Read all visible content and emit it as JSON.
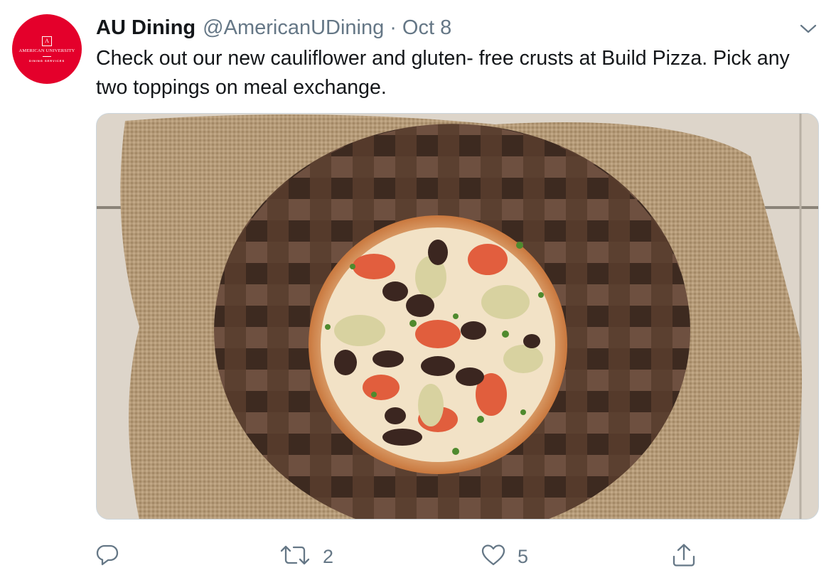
{
  "account": {
    "display_name": "AU Dining",
    "handle": "@AmericanUDining",
    "separator": "·",
    "date": "Oct 8",
    "avatar": {
      "color": "#e4002b",
      "line1": "AMERICAN UNIVERSITY",
      "line2": "DINING SERVICES"
    }
  },
  "tweet": {
    "text": "Check out our new cauliflower and gluten- free crusts at Build Pizza. Pick any two toppings on meal exchange."
  },
  "media": {
    "icon": "photo-pizza-on-wooden-board"
  },
  "actions": {
    "reply": {
      "icon": "reply-icon",
      "count": ""
    },
    "retweet": {
      "icon": "retweet-icon",
      "count": "2"
    },
    "like": {
      "icon": "heart-icon",
      "count": "5"
    },
    "share": {
      "icon": "share-icon",
      "count": ""
    }
  },
  "colors": {
    "text": "#14171a",
    "secondary": "#657786",
    "brand_red": "#e4002b"
  }
}
